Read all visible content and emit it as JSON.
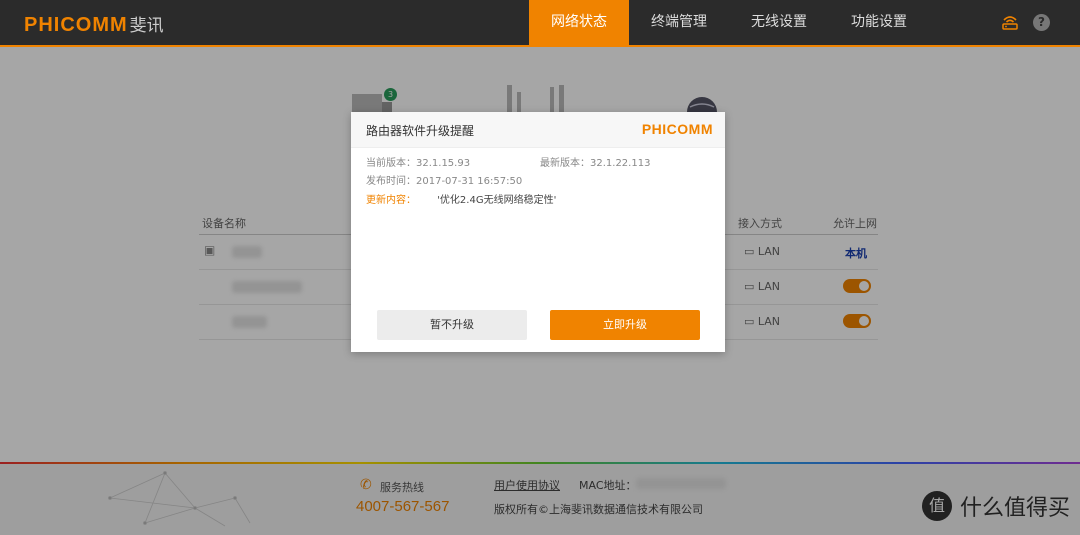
{
  "header": {
    "logo_text": "PHICOMM",
    "logo_cn": "斐讯",
    "nav": [
      "网络状态",
      "终端管理",
      "无线设置",
      "功能设置"
    ],
    "active_nav": 0,
    "help_symbol": "?"
  },
  "topology": {
    "badge_count": "3"
  },
  "device_table": {
    "headers": {
      "name": "设备名称",
      "access": "接入方式",
      "allow": "允许上网"
    },
    "rows": [
      {
        "icon": "pc-icon",
        "access": "LAN",
        "allow": "本机"
      },
      {
        "icon": "apple-icon",
        "access": "LAN",
        "allow": "toggle-on"
      },
      {
        "icon": "apple-icon",
        "access": "LAN",
        "allow": "toggle-on"
      }
    ]
  },
  "dialog": {
    "title": "路由器软件升级提醒",
    "logo": "PHICOMM",
    "current_label": "当前版本：",
    "current_version": "32.1.15.93",
    "latest_label": "最新版本：",
    "latest_version": "32.1.22.113",
    "release_label": "发布时间：",
    "release_time": "2017-07-31 16:57:50",
    "changes_label": "更新内容：",
    "changes_text": "'优化2.4G无线网络稳定性'",
    "later_button": "暂不升级",
    "upgrade_button": "立即升级"
  },
  "footer": {
    "hotline_label": "服务热线",
    "hotline_number": "4007-567-567",
    "agreement_link": "用户使用协议",
    "mac_label": "MAC地址：",
    "copyright": "版权所有©上海斐讯数据通信技术有限公司"
  },
  "watermark": {
    "icon_text": "值",
    "text": "什么值得买"
  },
  "colors": {
    "accent": "#f08300",
    "header_bg": "#2b2b2b",
    "link_blue": "#1a3fb0"
  }
}
